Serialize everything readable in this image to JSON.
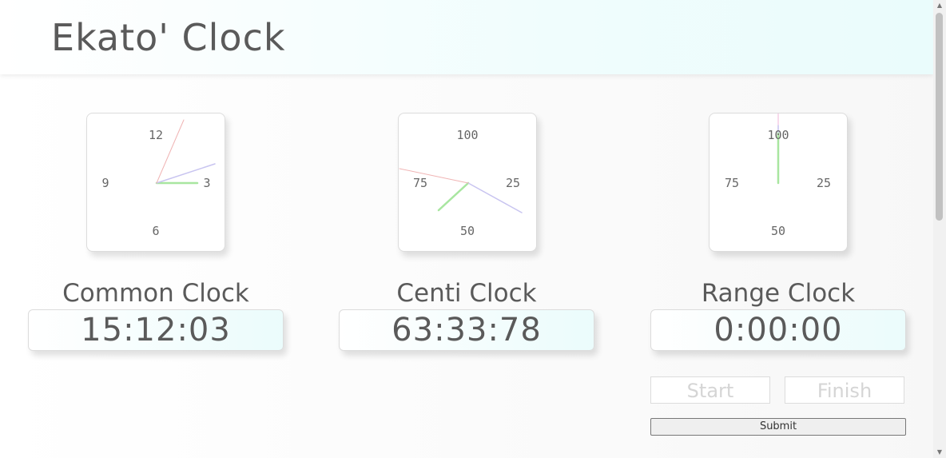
{
  "app": {
    "title": "Ekato' Clock"
  },
  "clocks": [
    {
      "name": "Common Clock",
      "time": "15:12:03",
      "labels": [
        "12",
        "3",
        "6",
        "9"
      ]
    },
    {
      "name": "Centi Clock",
      "time": "63:33:78",
      "labels": [
        "100",
        "25",
        "50",
        "75"
      ]
    },
    {
      "name": "Range Clock",
      "time": "0:00:00",
      "labels": [
        "100",
        "25",
        "50",
        "75"
      ]
    }
  ],
  "controls": {
    "start_label": "Start",
    "finish_label": "Finish",
    "submit_label": "Submit"
  },
  "colors": {
    "hour_hand": "#a8e6a0",
    "minute_hand": "#c8c4f0",
    "second_hand": "#f0b4b4"
  }
}
